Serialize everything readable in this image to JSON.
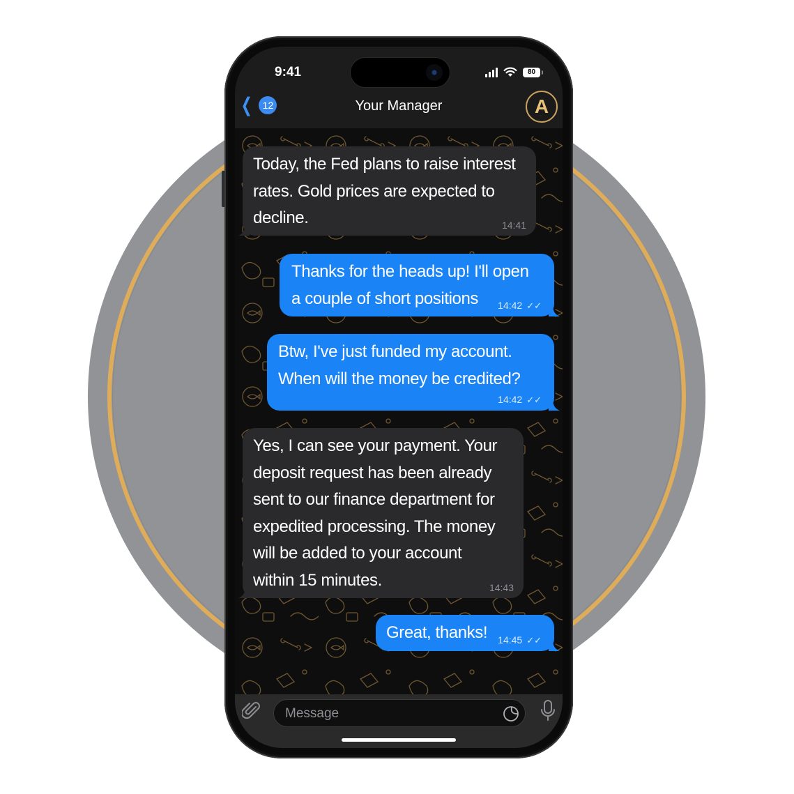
{
  "status_bar": {
    "time": "9:41",
    "battery": "80",
    "icons": [
      "signal-icon",
      "wifi-icon",
      "battery-icon"
    ]
  },
  "header": {
    "back_icon": "chevron-left-icon",
    "unread_count": "12",
    "title": "Your Manager",
    "avatar_letter": "A"
  },
  "colors": {
    "outgoing_bubble": "#1a84f7",
    "incoming_bubble": "#2a2a2c",
    "accent_gold": "#dfad5a",
    "circle_gray": "#919396"
  },
  "messages": [
    {
      "direction": "incoming",
      "lines": [
        "Today, the Fed plans to raise interest",
        "rates. Gold prices are expected to",
        "decline."
      ],
      "time": "14:41"
    },
    {
      "direction": "outgoing",
      "lines": [
        "Thanks for the heads up! I'll open",
        "a couple of short positions"
      ],
      "time": "14:42",
      "status": "read"
    },
    {
      "direction": "outgoing",
      "lines": [
        "Btw, I've just funded my account.",
        "When will the money be credited?"
      ],
      "time": "14:42",
      "status": "read"
    },
    {
      "direction": "incoming",
      "lines": [
        "Yes, I can see your payment. Your",
        "deposit request has been already",
        "sent to our finance department for",
        "expedited processing. The money",
        "will be added to your account",
        "within 15 minutes."
      ],
      "time": "14:43"
    },
    {
      "direction": "outgoing",
      "lines": [
        "Great, thanks!"
      ],
      "time": "14:45",
      "status": "read"
    }
  ],
  "input_bar": {
    "placeholder": "Message",
    "value": "",
    "icons": [
      "paperclip-icon",
      "sticker-icon",
      "microphone-icon"
    ]
  }
}
